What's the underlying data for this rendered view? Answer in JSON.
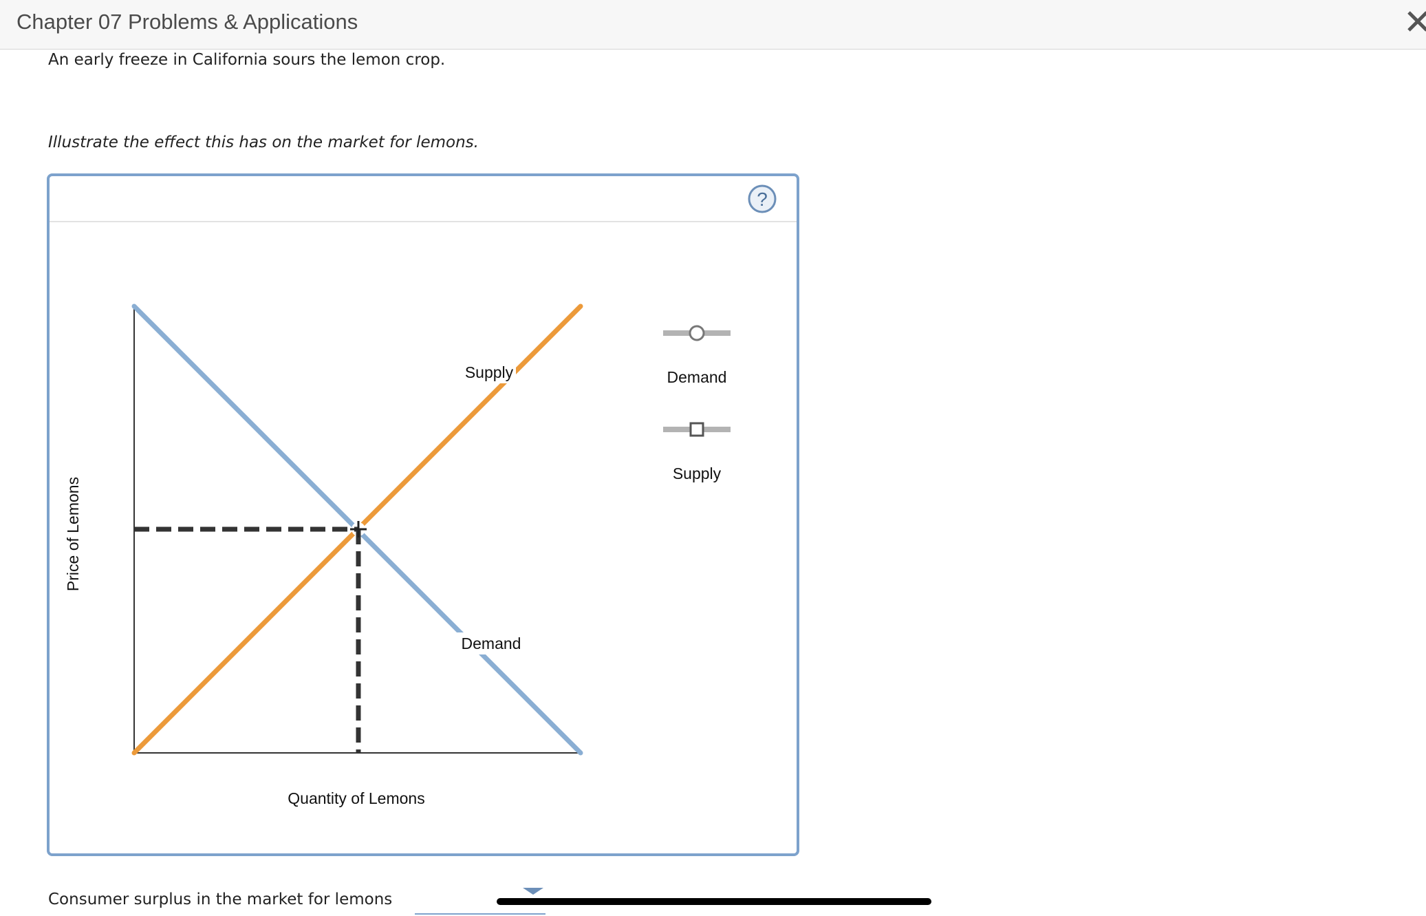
{
  "header": {
    "title": "Chapter 07 Problems & Applications"
  },
  "problem": {
    "intro": "An early freeze in California sours the lemon crop.",
    "instruction": "Illustrate the effect this has on the market for lemons."
  },
  "graph": {
    "help_label": "?",
    "x_axis_label": "Quantity of Lemons",
    "y_axis_label": "Price of Lemons",
    "curve_label_supply": "Supply",
    "curve_label_demand": "Demand",
    "palette": {
      "demand_item_label": "Demand",
      "supply_item_label": "Supply"
    },
    "colors": {
      "demand": "#8aaed3",
      "supply": "#ec9a3a",
      "panel_border": "#7da2cc",
      "equilibrium": "#333333"
    }
  },
  "question": {
    "text": "Consumer surplus in the market for lemons"
  }
}
